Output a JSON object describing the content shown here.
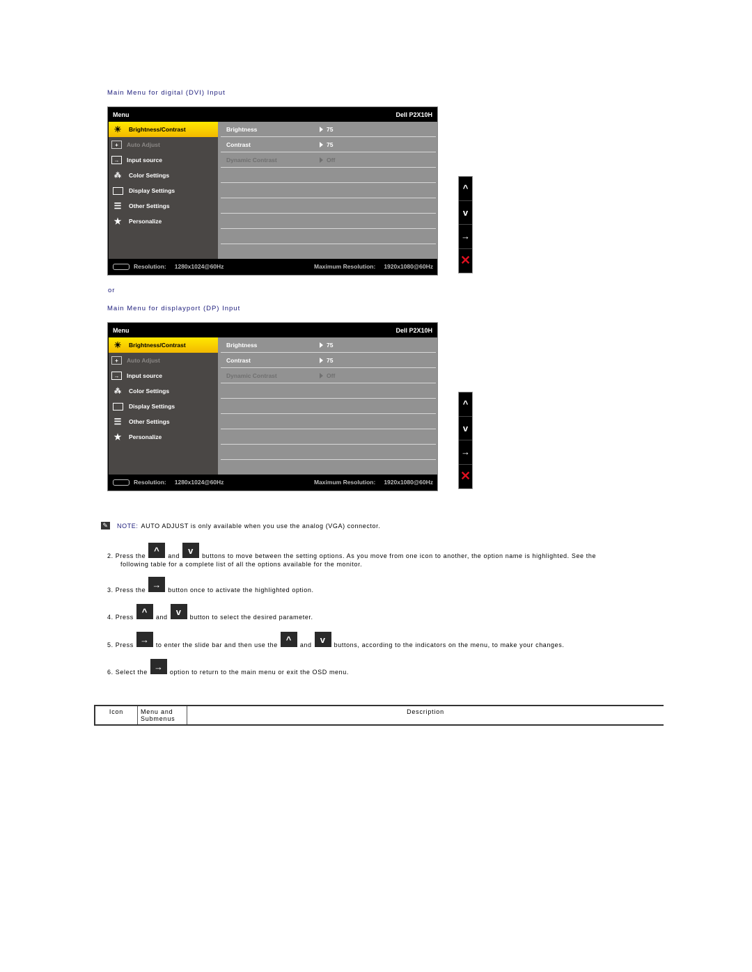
{
  "sections": [
    {
      "caption": "Main Menu for digital (DVI) Input",
      "osd": {
        "header_title": "Menu",
        "model": "Dell P2X10H",
        "menu_items": [
          {
            "label": "Brightness/Contrast",
            "icon": "sun-icon",
            "state": "selected"
          },
          {
            "label": "Auto Adjust",
            "icon": "auto-adjust-icon",
            "state": "disabled"
          },
          {
            "label": "Input source",
            "icon": "input-source-icon",
            "state": "normal"
          },
          {
            "label": "Color Settings",
            "icon": "color-dots-icon",
            "state": "normal"
          },
          {
            "label": "Display Settings",
            "icon": "display-rect-icon",
            "state": "normal"
          },
          {
            "label": "Other Settings",
            "icon": "sliders-icon",
            "state": "normal"
          },
          {
            "label": "Personalize",
            "icon": "star-icon",
            "state": "normal"
          }
        ],
        "settings": [
          {
            "label": "Brightness",
            "value": "75",
            "state": "normal"
          },
          {
            "label": "Contrast",
            "value": "75",
            "state": "normal"
          },
          {
            "label": "Dynamic Contrast",
            "value": "Off",
            "state": "disabled"
          }
        ],
        "footer": {
          "connector_icon": "dvi-connector-icon",
          "resolution_label": "Resolution:",
          "resolution_value": "1280x1024@60Hz",
          "max_label": "Maximum Resolution:",
          "max_value": "1920x1080@60Hz"
        }
      }
    },
    {
      "caption": "Main Menu for displayport (DP) Input",
      "osd": {
        "header_title": "Menu",
        "model": "Dell P2X10H",
        "menu_items": [
          {
            "label": "Brightness/Contrast",
            "icon": "sun-icon",
            "state": "selected"
          },
          {
            "label": "Auto Adjust",
            "icon": "auto-adjust-icon",
            "state": "disabled"
          },
          {
            "label": "Input source",
            "icon": "input-source-icon",
            "state": "normal"
          },
          {
            "label": "Color Settings",
            "icon": "color-dots-icon",
            "state": "normal"
          },
          {
            "label": "Display Settings",
            "icon": "display-rect-icon",
            "state": "normal"
          },
          {
            "label": "Other Settings",
            "icon": "sliders-icon",
            "state": "normal"
          },
          {
            "label": "Personalize",
            "icon": "star-icon",
            "state": "normal"
          }
        ],
        "settings": [
          {
            "label": "Brightness",
            "value": "75",
            "state": "normal"
          },
          {
            "label": "Contrast",
            "value": "75",
            "state": "normal"
          },
          {
            "label": "Dynamic Contrast",
            "value": "Off",
            "state": "disabled"
          }
        ],
        "footer": {
          "connector_icon": "displayport-connector-icon",
          "resolution_label": "Resolution:",
          "resolution_value": "1280x1024@60Hz",
          "max_label": "Maximum Resolution:",
          "max_value": "1920x1080@60Hz"
        }
      }
    }
  ],
  "or_text": "or",
  "side_buttons": [
    {
      "name": "up-button",
      "glyph": "^"
    },
    {
      "name": "down-button",
      "glyph": "v"
    },
    {
      "name": "enter-button",
      "glyph": "→"
    },
    {
      "name": "exit-button",
      "glyph": "✕"
    }
  ],
  "note": {
    "label": "NOTE:",
    "text": "AUTO ADJUST is only available when you use the analog (VGA) connector."
  },
  "steps": {
    "s2": {
      "a": "2. Press the",
      "b": "and",
      "c": "buttons to move between the setting options. As you move from one icon to another, the option name is highlighted. See the",
      "d": "following table for a complete list of all the options available for the monitor."
    },
    "s3": {
      "a": "3. Press the",
      "b": "button once to activate the highlighted option."
    },
    "s4": {
      "a": "4. Press",
      "b": "and",
      "c": "button to select the desired parameter."
    },
    "s5": {
      "a": "5. Press",
      "b": "to enter the slide bar and then use the",
      "c": "and",
      "d": "buttons, according to the indicators on the menu, to make your changes."
    },
    "s6": {
      "a": "6. Select the",
      "b": "option to return to the main menu or exit the OSD menu."
    }
  },
  "key_glyphs": {
    "up": "^",
    "down": "v",
    "enter": "→"
  },
  "table": {
    "headers": [
      "Icon",
      "Menu and Submenus",
      "Description"
    ]
  },
  "colors": {
    "caption": "#1a1a7a",
    "selected_highlight": "#ffe800",
    "exit_red": "#e01020"
  }
}
